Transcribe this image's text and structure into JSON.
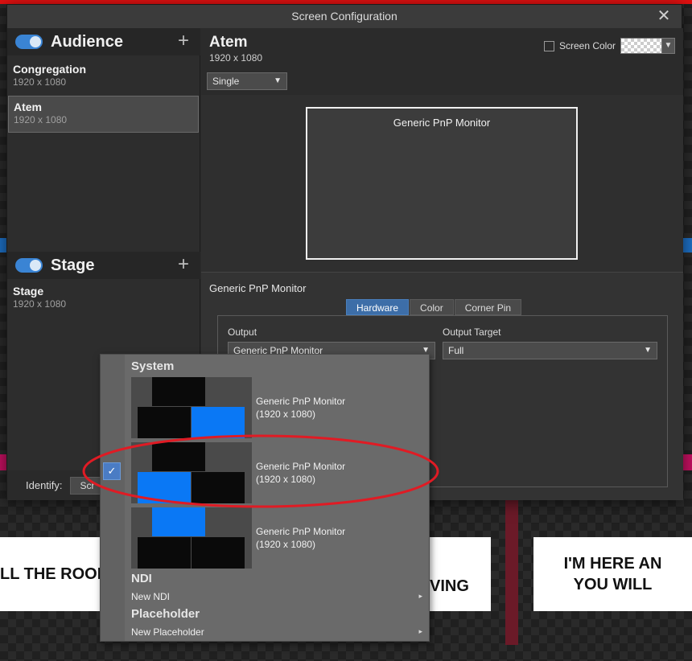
{
  "background": {
    "cards": [
      {
        "text": "LL THE ROOM"
      },
      {
        "text": "VING"
      },
      {
        "text": "I'M HERE AN\nYOU WILL"
      }
    ]
  },
  "dialog": {
    "title": "Screen Configuration",
    "close_glyph": "✕",
    "left": {
      "groups": [
        {
          "name": "Audience",
          "enabled": true
        },
        {
          "name": "Stage",
          "enabled": true
        }
      ],
      "audience_screens": [
        {
          "name": "Congregation",
          "res": "1920 x 1080"
        },
        {
          "name": "Atem",
          "res": "1920 x 1080"
        }
      ],
      "stage_screens": [
        {
          "name": "Stage",
          "res": "1920 x 1080"
        }
      ],
      "plus_glyph": "+",
      "identify_label": "Identify:",
      "identify_button": "Scr"
    },
    "right": {
      "title": "Atem",
      "res": "1920 x 1080",
      "screen_color_label": "Screen Color",
      "mode_value": "Single",
      "monitor_label": "Generic PnP Monitor",
      "config_title": "Generic PnP Monitor",
      "tabs": [
        "Hardware",
        "Color",
        "Corner Pin"
      ],
      "output_label": "Output",
      "output_value": "Generic PnP Monitor",
      "output_target_label": "Output Target",
      "output_target_value": "Full"
    }
  },
  "popup": {
    "system_label": "System",
    "displays": [
      {
        "name": "Generic PnP Monitor",
        "res": "(1920 x 1080)",
        "checked": false
      },
      {
        "name": "Generic PnP Monitor",
        "res": "(1920 x 1080)",
        "checked": true
      },
      {
        "name": "Generic PnP Monitor",
        "res": "(1920 x 1080)",
        "checked": false
      }
    ],
    "ndi_label": "NDI",
    "new_ndi": "New NDI",
    "placeholder_label": "Placeholder",
    "new_placeholder": "New Placeholder",
    "check_glyph": "✓",
    "arrow_glyph": "▸"
  },
  "colors": {
    "accent_blue": "#3d6ea8",
    "display_blue": "#0a78f5",
    "annotation_red": "#e01b24"
  }
}
